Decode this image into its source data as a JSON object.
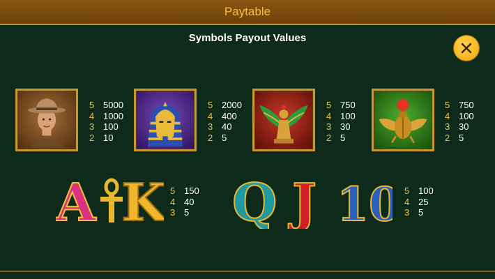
{
  "header": {
    "title": "Paytable"
  },
  "subtitle": "Symbols Payout Values",
  "colors": {
    "background": "#0e2a1a",
    "accent": "#f3c23c",
    "header": "#7a4a0e"
  },
  "symbols": [
    {
      "name": "explorer",
      "pays": [
        {
          "count": "5",
          "value": "5000"
        },
        {
          "count": "4",
          "value": "1000"
        },
        {
          "count": "3",
          "value": "100"
        },
        {
          "count": "2",
          "value": "10"
        }
      ]
    },
    {
      "name": "pharaoh mask",
      "pays": [
        {
          "count": "5",
          "value": "2000"
        },
        {
          "count": "4",
          "value": "400"
        },
        {
          "count": "3",
          "value": "40"
        },
        {
          "count": "2",
          "value": "5"
        }
      ]
    },
    {
      "name": "winged goddess",
      "pays": [
        {
          "count": "5",
          "value": "750"
        },
        {
          "count": "4",
          "value": "100"
        },
        {
          "count": "3",
          "value": "30"
        },
        {
          "count": "2",
          "value": "5"
        }
      ]
    },
    {
      "name": "scarab",
      "pays": [
        {
          "count": "5",
          "value": "750"
        },
        {
          "count": "4",
          "value": "100"
        },
        {
          "count": "3",
          "value": "30"
        },
        {
          "count": "2",
          "value": "5"
        }
      ]
    }
  ],
  "card_groups": [
    {
      "letters": [
        "A",
        "K"
      ],
      "pays": [
        {
          "count": "5",
          "value": "150"
        },
        {
          "count": "4",
          "value": "40"
        },
        {
          "count": "3",
          "value": "5"
        }
      ]
    },
    {
      "letters": [
        "Q",
        "J",
        "10"
      ],
      "pays": [
        {
          "count": "5",
          "value": "100"
        },
        {
          "count": "4",
          "value": "25"
        },
        {
          "count": "3",
          "value": "5"
        }
      ]
    }
  ],
  "icons": {
    "close": "close-icon"
  }
}
